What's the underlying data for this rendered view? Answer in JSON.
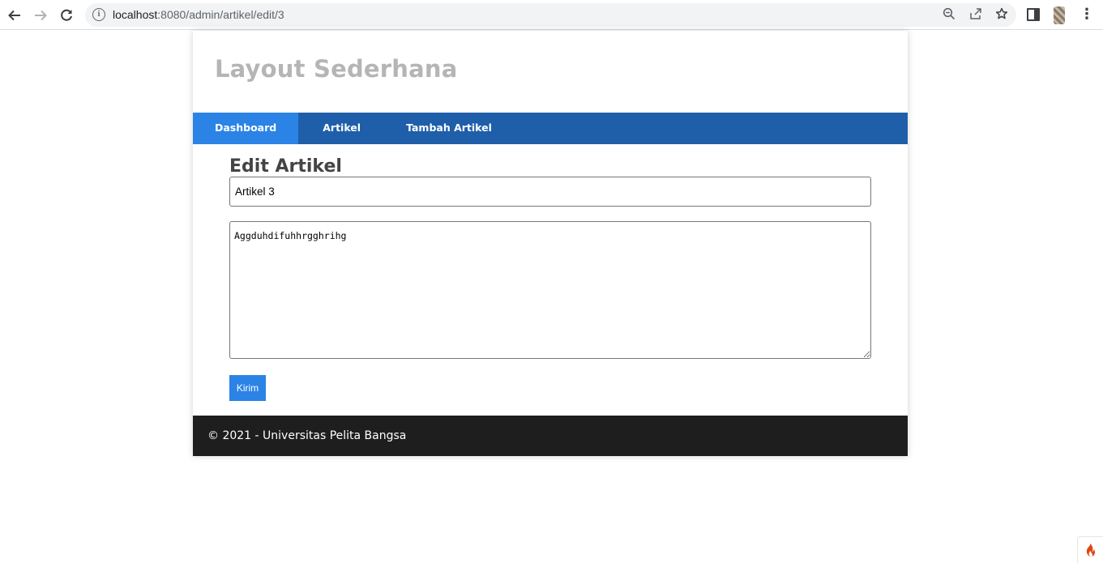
{
  "browser": {
    "url_host": "localhost",
    "url_path": ":8080/admin/artikel/edit/3",
    "icons": [
      "back-arrow-icon",
      "forward-arrow-icon",
      "reload-icon",
      "site-info-icon",
      "zoom-icon",
      "share-icon",
      "bookmark-star-icon",
      "side-panel-icon",
      "profile-avatar-icon",
      "more-menu-icon"
    ]
  },
  "site": {
    "title": "Layout Sederhana",
    "nav": [
      {
        "label": "Dashboard",
        "active": true
      },
      {
        "label": "Artikel",
        "active": false
      },
      {
        "label": "Tambah Artikel",
        "active": false
      }
    ]
  },
  "form": {
    "heading": "Edit Artikel",
    "title_value": "Artikel 3",
    "content_value": "Aggduhdifuhhrgghrihg",
    "submit_label": "Kirim"
  },
  "footer": {
    "text": "© 2021 - Universitas Pelita Bangsa"
  },
  "colors": {
    "nav_bg": "#1f5faa",
    "nav_active": "#2b83e6",
    "button": "#2b83e6",
    "footer_bg": "#1e1e1e",
    "title_color": "#b5b5b5",
    "toolbar_icon": "codeigniter-flame-icon"
  }
}
